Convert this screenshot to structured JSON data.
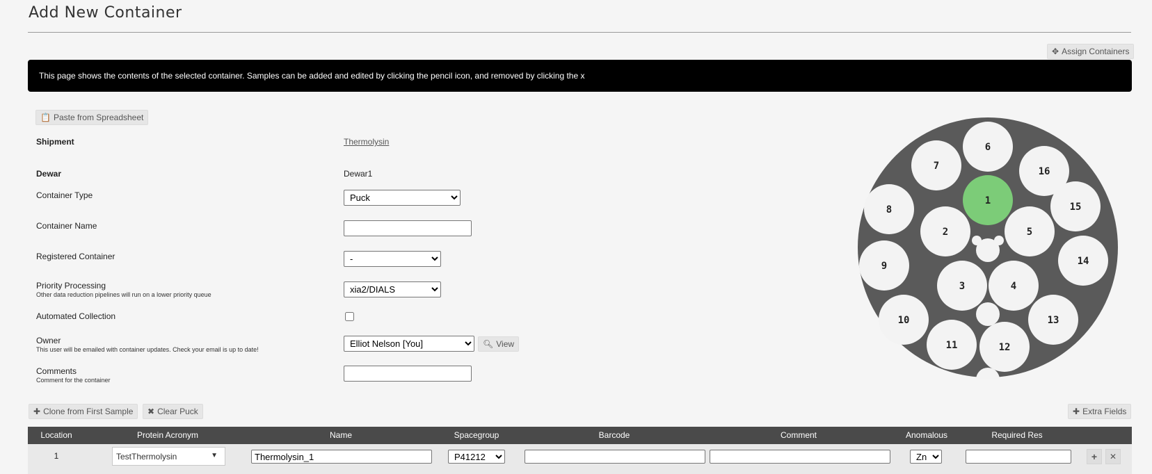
{
  "page": {
    "title": "Add New Container",
    "assign_button": "Assign Containers",
    "banner": "This page shows the contents of the selected container. Samples can be added and edited by clicking the pencil icon, and removed by clicking the x",
    "paste_button": "Paste from Spreadsheet"
  },
  "form": {
    "shipment": {
      "label": "Shipment",
      "value": "Thermolysin"
    },
    "dewar": {
      "label": "Dewar",
      "value": "Dewar1"
    },
    "container_type": {
      "label": "Container Type",
      "value": "Puck"
    },
    "container_name": {
      "label": "Container Name",
      "value": ""
    },
    "registered_container": {
      "label": "Registered Container",
      "value": "-"
    },
    "priority_processing": {
      "label": "Priority Processing",
      "help": "Other data reduction pipelines will run on a lower priority queue",
      "value": "xia2/DIALS"
    },
    "automated_collection": {
      "label": "Automated Collection",
      "checked": false
    },
    "owner": {
      "label": "Owner",
      "help": "This user will be emailed with container updates. Check your email is up to date!",
      "value": "Elliot Nelson [You]",
      "view_button": "View"
    },
    "comments": {
      "label": "Comments",
      "help": "Comment for the container",
      "value": ""
    }
  },
  "puck": {
    "positions": [
      "1",
      "2",
      "3",
      "4",
      "5",
      "6",
      "7",
      "8",
      "9",
      "10",
      "11",
      "12",
      "13",
      "14",
      "15",
      "16"
    ],
    "selected": "1",
    "colors": {
      "body": "#5a5a5a",
      "slot": "#f3f3f3",
      "selected": "#7ccc78"
    }
  },
  "toolbar": {
    "clone_button": "Clone from First Sample",
    "clear_button": "Clear Puck",
    "extra_fields_button": "Extra Fields"
  },
  "table": {
    "headers": [
      "Location",
      "Protein Acronym",
      "Name",
      "Spacegroup",
      "Barcode",
      "Comment",
      "Anomalous",
      "Required Res"
    ],
    "rows": [
      {
        "location": "1",
        "protein": "TestThermolysin",
        "name": "Thermolysin_1",
        "spacegroup": "P41212",
        "barcode": "",
        "comment": "",
        "anomalous": "Zn",
        "required_res": ""
      }
    ]
  }
}
